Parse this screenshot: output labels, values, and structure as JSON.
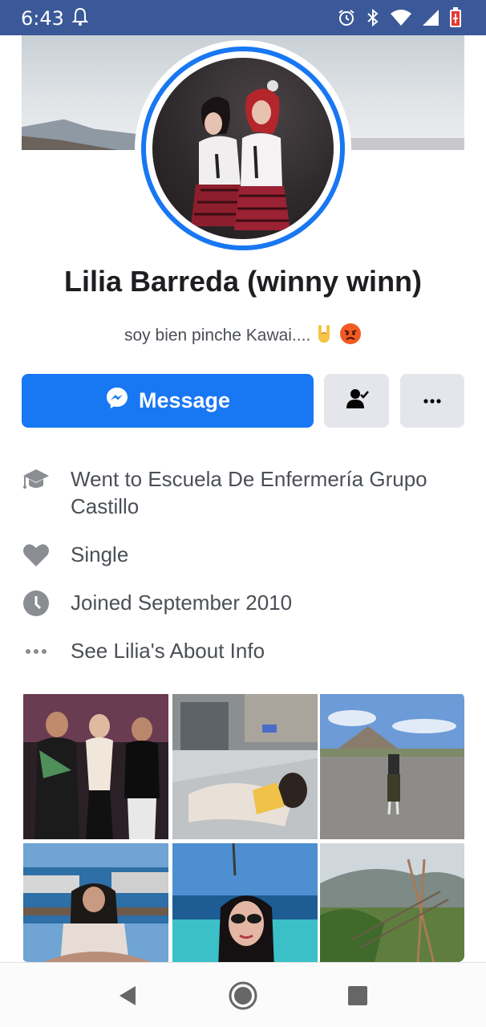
{
  "status_bar": {
    "time": "6:43",
    "icons": [
      "bell-icon",
      "alarm-icon",
      "bluetooth-icon",
      "wifi-icon",
      "signal-icon",
      "battery-icon"
    ]
  },
  "profile": {
    "name": "Lilia Barreda (winny winn)",
    "bio": "soy bien pinche Kawai....",
    "bio_emojis": [
      "rock-hand-emoji",
      "angry-face-emoji"
    ]
  },
  "actions": {
    "message_label": "Message",
    "friend_icon": "friend-status-icon",
    "more_icon": "more-icon"
  },
  "info": {
    "education": "Went to Escuela De Enfermería Grupo Castillo",
    "relationship": "Single",
    "joined": "Joined September 2010",
    "about_link": "See Lilia's About Info"
  },
  "photos": [
    {
      "icon": "photo-group-icon"
    },
    {
      "icon": "photo-pool-icon"
    },
    {
      "icon": "photo-pyramid-icon"
    },
    {
      "icon": "photo-marina-icon"
    },
    {
      "icon": "photo-selfie-icon"
    },
    {
      "icon": "photo-hills-icon"
    }
  ],
  "colors": {
    "status_bar": "#3b5998",
    "accent": "#1877f2",
    "button_gray": "#e4e6eb",
    "text_secondary": "#4b4f56"
  }
}
